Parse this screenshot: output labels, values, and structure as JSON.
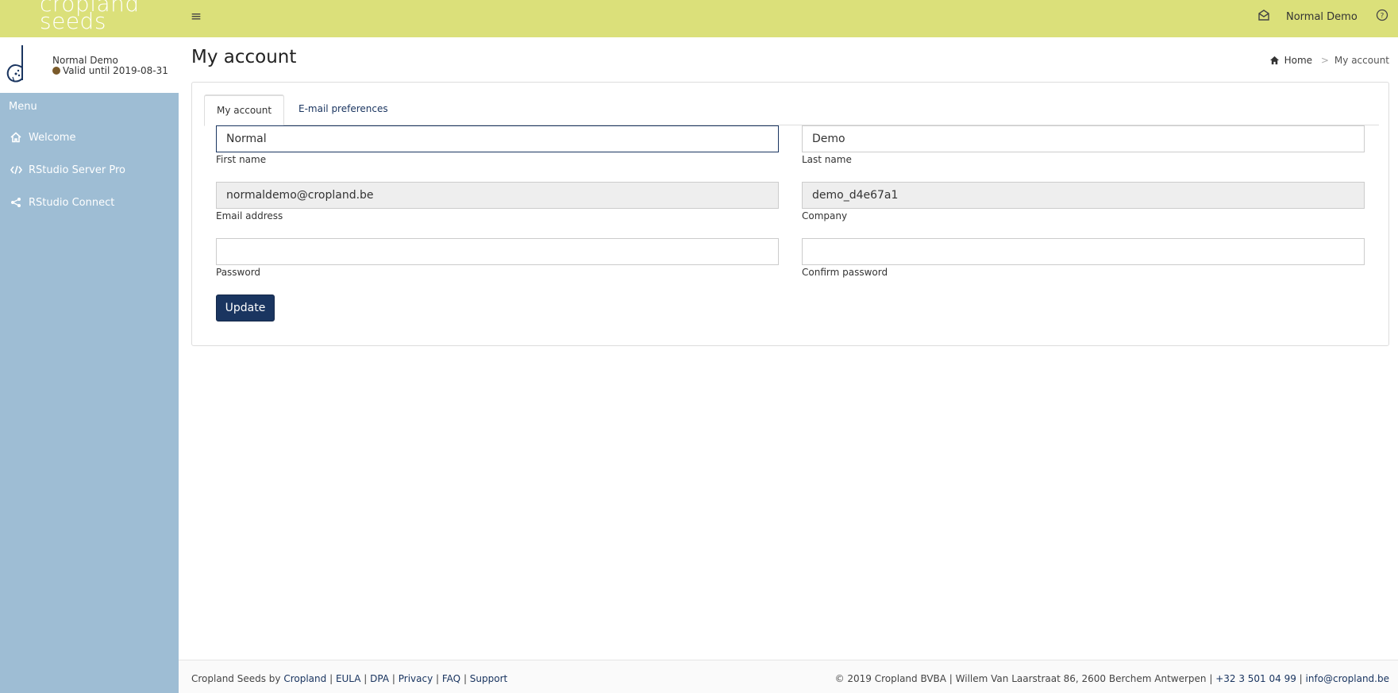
{
  "brand": {
    "line1": "cropland",
    "line2": "seeds"
  },
  "topbar": {
    "user_name": "Normal Demo"
  },
  "sidebar": {
    "user_name": "Normal Demo",
    "valid_until": "Valid until 2019-08-31",
    "menu_header": "Menu",
    "items": [
      {
        "label": "Welcome",
        "icon": "home-icon"
      },
      {
        "label": "RStudio Server Pro",
        "icon": "code-icon"
      },
      {
        "label": "RStudio Connect",
        "icon": "share-icon"
      }
    ]
  },
  "page": {
    "title": "My account"
  },
  "breadcrumb": {
    "home": "Home",
    "current": "My account"
  },
  "tabs": [
    {
      "label": "My account",
      "active": true
    },
    {
      "label": "E-mail preferences",
      "active": false
    }
  ],
  "form": {
    "first_name": {
      "value": "Normal",
      "label": "First name"
    },
    "last_name": {
      "value": "Demo",
      "label": "Last name"
    },
    "email": {
      "value": "normaldemo@cropland.be",
      "label": "Email address"
    },
    "company": {
      "value": "demo_d4e67a1",
      "label": "Company"
    },
    "password": {
      "value": "",
      "label": "Password"
    },
    "confirm_password": {
      "value": "",
      "label": "Confirm password"
    },
    "submit_label": "Update"
  },
  "footer": {
    "left_prefix": "Cropland Seeds by ",
    "links": [
      "Cropland",
      "EULA",
      "DPA",
      "Privacy",
      "FAQ",
      "Support"
    ],
    "right_text": "© 2019 Cropland BVBA | Willem Van Laarstraat 86, 2600 Berchem Antwerpen | ",
    "phone": "+32 3 501 04 99",
    "email": "info@cropland.be"
  },
  "colors": {
    "topbar": "#dbe07a",
    "sidebar": "#9ebdd4",
    "primary": "#1a3560",
    "status_dot": "#7a5a2a"
  }
}
